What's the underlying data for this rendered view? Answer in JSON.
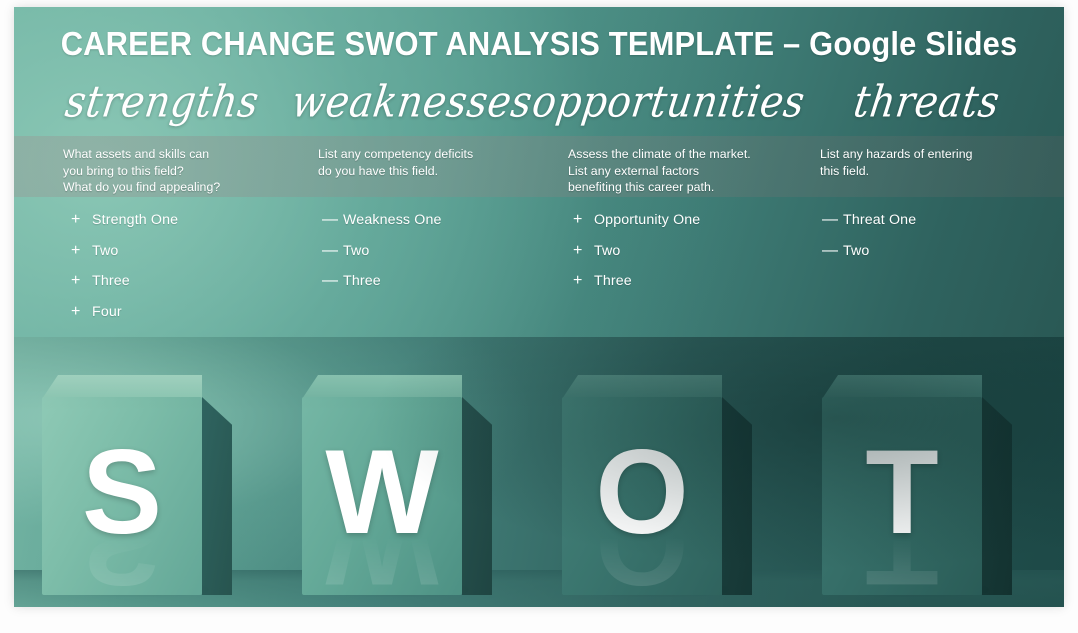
{
  "title": "CAREER CHANGE SWOT ANALYSIS TEMPLATE  –  Google Slides",
  "columns": [
    {
      "heading": "strengths",
      "prompt": "What assets and skills can\nyou bring to this field?\nWhat do you find appealing?",
      "mark": "+",
      "items": [
        "Strength One",
        "Two",
        "Three",
        "Four"
      ]
    },
    {
      "heading": "weaknesses",
      "prompt": "List any competency deficits\ndo you have this field.",
      "mark": "—",
      "items": [
        "Weakness One",
        "Two",
        "Three"
      ]
    },
    {
      "heading": "opportunities",
      "prompt": "Assess the climate of the market.\nList any external factors\nbenefiting this career path.",
      "mark": "+",
      "items": [
        "Opportunity One",
        "Two",
        "Three"
      ]
    },
    {
      "heading": "threats",
      "prompt": "List any hazards of entering\nthis field.",
      "mark": "—",
      "items": [
        "Threat One",
        "Two"
      ]
    }
  ],
  "photo": {
    "cubes": [
      {
        "letter": "S"
      },
      {
        "letter": "W"
      },
      {
        "letter": "O"
      },
      {
        "letter": "T"
      }
    ]
  },
  "colors": {
    "slide_light_teal": "#76b8a5",
    "slide_dark_teal": "#27534f",
    "band_overlay": "#8a9a95",
    "text_white": "#ffffff"
  }
}
